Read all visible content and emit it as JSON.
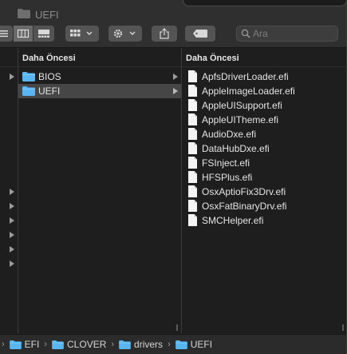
{
  "window": {
    "title": "UEFI"
  },
  "toolbar": {
    "view_buttons": [
      "icon-view",
      "list-view",
      "column-view",
      "gallery-view"
    ],
    "group_icon": "group-icon",
    "action_icon": "gear-icon",
    "share_icon": "share-icon",
    "tag_icon": "tag-icon",
    "search_placeholder": "Ara"
  },
  "columns": [
    {
      "header": "",
      "chevron_rows": [
        8,
        9,
        10,
        11,
        12,
        13
      ]
    },
    {
      "header": "Daha Öncesi",
      "items": [
        {
          "label": "BIOS",
          "type": "folder",
          "selected": false
        },
        {
          "label": "UEFI",
          "type": "folder",
          "selected": true
        }
      ]
    },
    {
      "header": "Daha Öncesi",
      "items": [
        {
          "label": "ApfsDriverLoader.efi",
          "type": "file"
        },
        {
          "label": "AppleImageLoader.efi",
          "type": "file"
        },
        {
          "label": "AppleUISupport.efi",
          "type": "file"
        },
        {
          "label": "AppleUITheme.efi",
          "type": "file"
        },
        {
          "label": "AudioDxe.efi",
          "type": "file"
        },
        {
          "label": "DataHubDxe.efi",
          "type": "file"
        },
        {
          "label": "FSInject.efi",
          "type": "file"
        },
        {
          "label": "HFSPlus.efi",
          "type": "file"
        },
        {
          "label": "OsxAptioFix3Drv.efi",
          "type": "file"
        },
        {
          "label": "OsxFatBinaryDrv.efi",
          "type": "file"
        },
        {
          "label": "SMCHelper.efi",
          "type": "file"
        }
      ]
    }
  ],
  "pathbar": {
    "crumbs": [
      "EFI",
      "CLOVER",
      "drivers",
      "UEFI"
    ]
  },
  "colors": {
    "folder": "#5ab6f0",
    "window_bg": "#1e1e1e",
    "toolbar_bg": "#2f2f2f",
    "selection": "#464646"
  }
}
